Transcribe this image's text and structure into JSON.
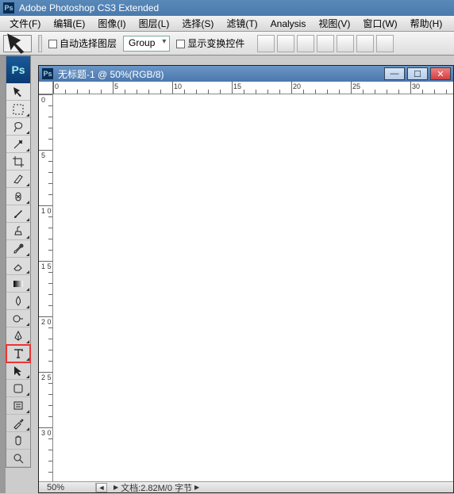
{
  "app": {
    "title": "Adobe Photoshop CS3 Extended",
    "ps_badge": "Ps"
  },
  "menu": {
    "items": [
      "文件(F)",
      "编辑(E)",
      "图像(I)",
      "图层(L)",
      "选择(S)",
      "滤镜(T)",
      "Analysis",
      "视图(V)",
      "窗口(W)",
      "帮助(H)"
    ]
  },
  "options": {
    "auto_select_label": "自动选择图层",
    "group_label": "Group",
    "show_transform_label": "显示变换控件"
  },
  "tools": [
    {
      "name": "move-tool"
    },
    {
      "name": "marquee-tool"
    },
    {
      "name": "lasso-tool"
    },
    {
      "name": "magic-wand-tool"
    },
    {
      "name": "crop-tool"
    },
    {
      "name": "slice-tool"
    },
    {
      "name": "healing-brush-tool"
    },
    {
      "name": "brush-tool"
    },
    {
      "name": "clone-stamp-tool"
    },
    {
      "name": "history-brush-tool"
    },
    {
      "name": "eraser-tool"
    },
    {
      "name": "gradient-tool"
    },
    {
      "name": "blur-tool"
    },
    {
      "name": "dodge-tool"
    },
    {
      "name": "pen-tool"
    },
    {
      "name": "type-tool",
      "highlight": true
    },
    {
      "name": "path-selection-tool"
    },
    {
      "name": "shape-tool"
    },
    {
      "name": "notes-tool"
    },
    {
      "name": "eyedropper-tool"
    },
    {
      "name": "hand-tool"
    },
    {
      "name": "zoom-tool"
    }
  ],
  "document": {
    "title": "无标题-1 @ 50%(RGB/8)",
    "zoom": "50%",
    "info_label": "文档:2.82M/0 字节",
    "ruler_h": [
      "0",
      "5",
      "10",
      "15",
      "20",
      "25",
      "30"
    ],
    "ruler_v": [
      "0",
      "5",
      "1 0",
      "1 5",
      "2 0",
      "2 5",
      "3 0"
    ]
  }
}
